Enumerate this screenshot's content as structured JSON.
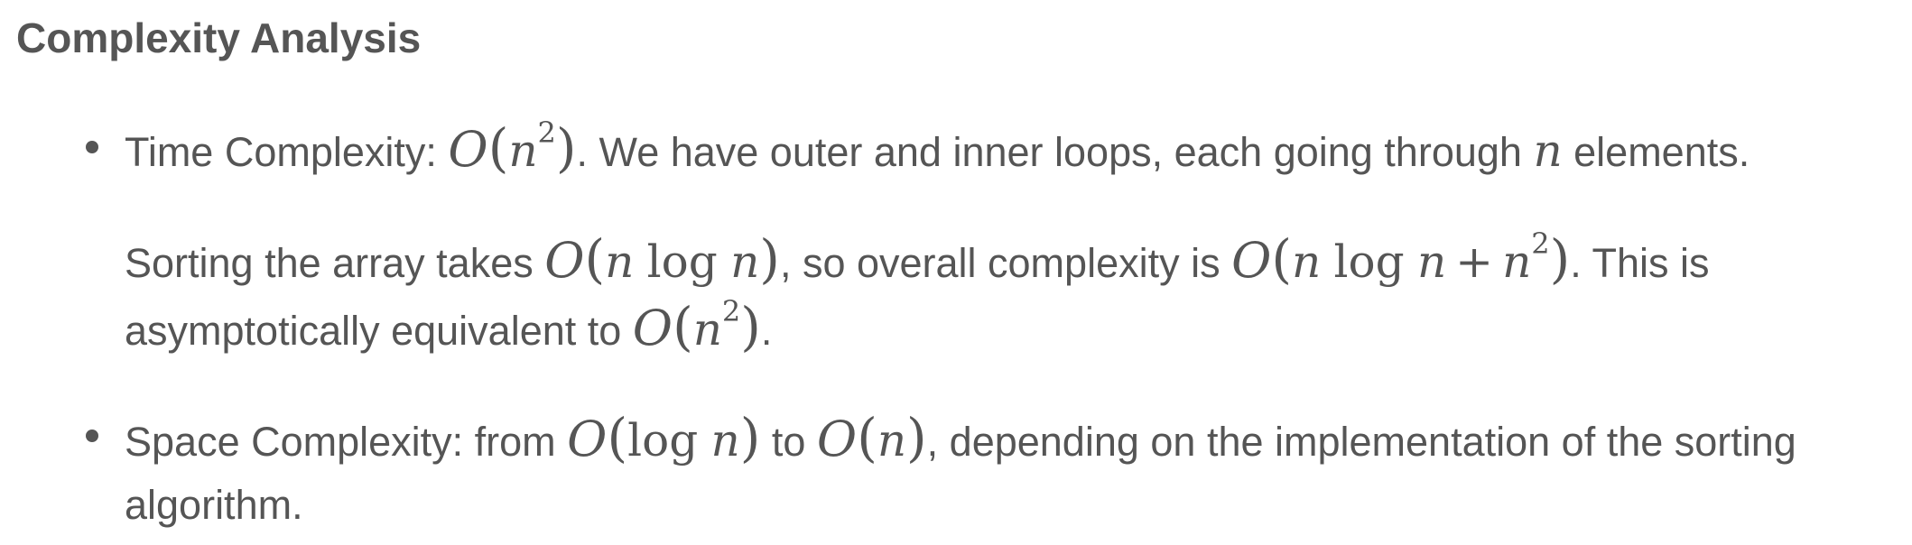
{
  "heading": "Complexity Analysis",
  "items": [
    {
      "time_prefix": "Time Complexity: ",
      "time_complexity": "O(n^2)",
      "time_rest": ". We have outer and inner loops, each going through ",
      "var_n": "n",
      "time_end": " elements.",
      "sorting_prefix": "Sorting the array takes ",
      "sorting_complexity": "O(n log n)",
      "sorting_mid": ", so overall complexity is ",
      "overall_complexity": "O(n log n + n^2)",
      "sorting_end": ". This is",
      "asym_prefix": "asymptotically equivalent to ",
      "asym_complexity": "O(n^2)",
      "asym_end": "."
    },
    {
      "space_prefix": "Space Complexity: from ",
      "space_from": "O(log n)",
      "space_mid": " to ",
      "space_to": "O(n)",
      "space_rest": ", depending on the implementation of the sorting",
      "space_cont": "algorithm."
    }
  ]
}
